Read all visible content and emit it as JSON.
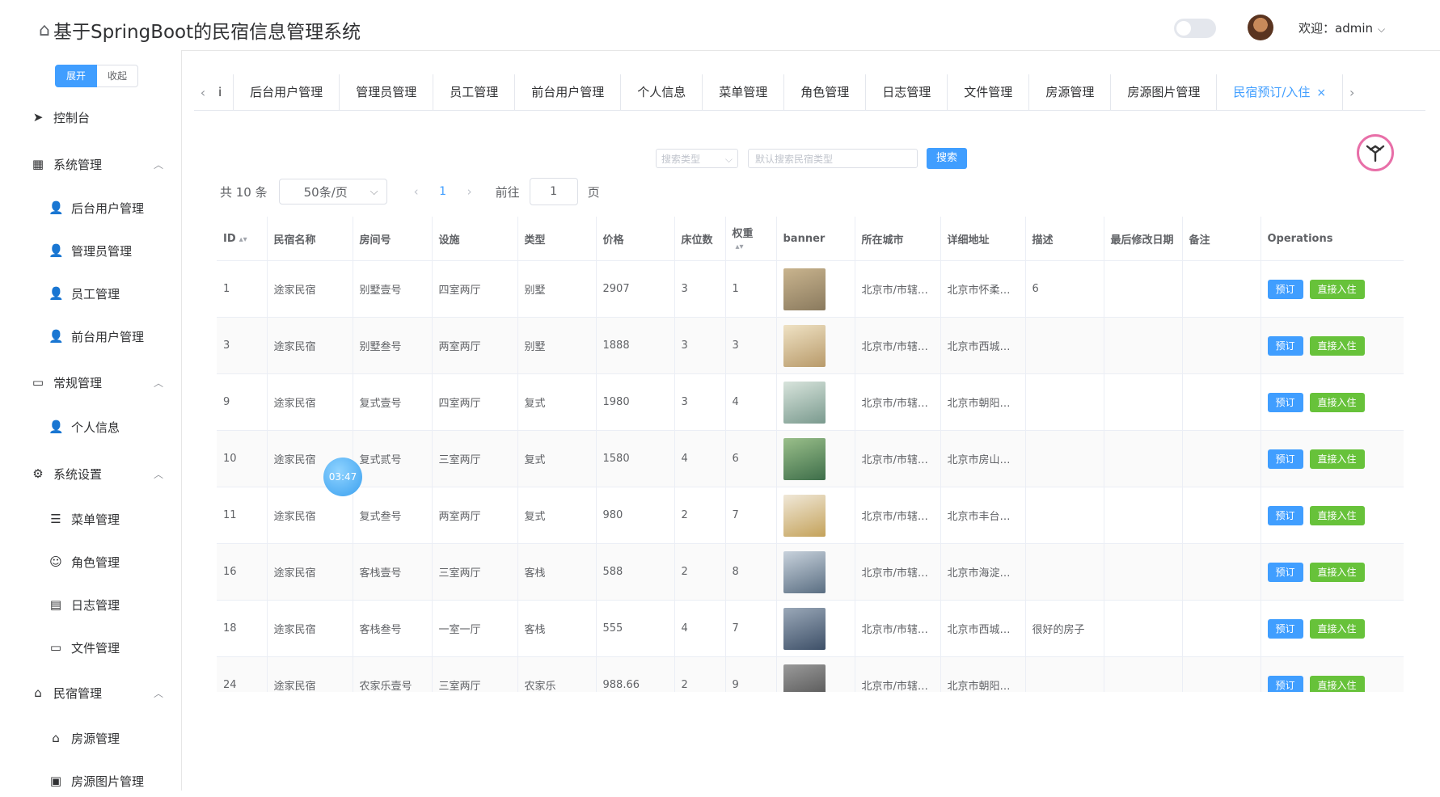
{
  "header": {
    "title": "基于SpringBoot的民宿信息管理系统",
    "welcome": "欢迎：admin"
  },
  "sidebar": {
    "expand_label": "展开",
    "collapse_label": "收起",
    "items": [
      {
        "label": "控制台",
        "icon": "send-icon"
      },
      {
        "label": "系统管理",
        "icon": "grid-icon"
      },
      {
        "label": "后台用户管理",
        "icon": "user-icon"
      },
      {
        "label": "管理员管理",
        "icon": "user-icon"
      },
      {
        "label": "员工管理",
        "icon": "user-icon"
      },
      {
        "label": "前台用户管理",
        "icon": "user-icon"
      },
      {
        "label": "常规管理",
        "icon": "card-icon"
      },
      {
        "label": "个人信息",
        "icon": "user-icon"
      },
      {
        "label": "系统设置",
        "icon": "gear-icon"
      },
      {
        "label": "菜单管理",
        "icon": "sliders-icon"
      },
      {
        "label": "角色管理",
        "icon": "user-outline-icon"
      },
      {
        "label": "日志管理",
        "icon": "calendar-icon"
      },
      {
        "label": "文件管理",
        "icon": "folder-icon"
      },
      {
        "label": "民宿管理",
        "icon": "home-icon"
      },
      {
        "label": "房源管理",
        "icon": "home-icon"
      },
      {
        "label": "房源图片管理",
        "icon": "image-icon"
      }
    ]
  },
  "tabs": [
    {
      "label": "i"
    },
    {
      "label": "后台用户管理"
    },
    {
      "label": "管理员管理"
    },
    {
      "label": "员工管理"
    },
    {
      "label": "前台用户管理"
    },
    {
      "label": "个人信息"
    },
    {
      "label": "菜单管理"
    },
    {
      "label": "角色管理"
    },
    {
      "label": "日志管理"
    },
    {
      "label": "文件管理"
    },
    {
      "label": "房源管理"
    },
    {
      "label": "房源图片管理"
    },
    {
      "label": "民宿预订/入住",
      "active": true
    }
  ],
  "search": {
    "type_placeholder": "搜索类型",
    "input_placeholder": "默认搜索民宿类型",
    "button": "搜索"
  },
  "pagination": {
    "total": "共 10 条",
    "page_size": "50条/页",
    "current_page": "1",
    "goto_label": "前往",
    "goto_value": "1",
    "page_suffix": "页"
  },
  "table": {
    "headers": [
      "ID",
      "民宿名称",
      "房间号",
      "设施",
      "类型",
      "价格",
      "床位数",
      "权重",
      "banner",
      "所在城市",
      "详细地址",
      "描述",
      "最后修改日期",
      "备注",
      "Operations"
    ],
    "book_label": "预订",
    "checkin_label": "直接入住",
    "rows": [
      {
        "id": "1",
        "name": "途家民宿",
        "room": "别墅壹号",
        "facility": "四室两厅",
        "type": "别墅",
        "price": "2907",
        "beds": "3",
        "weight": "1",
        "city": "北京市/市辖…",
        "address": "北京市怀柔…",
        "desc": "6",
        "modified": "",
        "note": ""
      },
      {
        "id": "3",
        "name": "途家民宿",
        "room": "别墅叁号",
        "facility": "两室两厅",
        "type": "别墅",
        "price": "1888",
        "beds": "3",
        "weight": "3",
        "city": "北京市/市辖…",
        "address": "北京市西城…",
        "desc": "",
        "modified": "",
        "note": ""
      },
      {
        "id": "9",
        "name": "途家民宿",
        "room": "复式壹号",
        "facility": "四室两厅",
        "type": "复式",
        "price": "1980",
        "beds": "3",
        "weight": "4",
        "city": "北京市/市辖…",
        "address": "北京市朝阳…",
        "desc": "",
        "modified": "",
        "note": ""
      },
      {
        "id": "10",
        "name": "途家民宿",
        "room": "复式贰号",
        "facility": "三室两厅",
        "type": "复式",
        "price": "1580",
        "beds": "4",
        "weight": "6",
        "city": "北京市/市辖…",
        "address": "北京市房山…",
        "desc": "",
        "modified": "",
        "note": ""
      },
      {
        "id": "11",
        "name": "途家民宿",
        "room": "复式叁号",
        "facility": "两室两厅",
        "type": "复式",
        "price": "980",
        "beds": "2",
        "weight": "7",
        "city": "北京市/市辖…",
        "address": "北京市丰台…",
        "desc": "",
        "modified": "",
        "note": ""
      },
      {
        "id": "16",
        "name": "途家民宿",
        "room": "客栈壹号",
        "facility": "三室两厅",
        "type": "客栈",
        "price": "588",
        "beds": "2",
        "weight": "8",
        "city": "北京市/市辖…",
        "address": "北京市海淀…",
        "desc": "",
        "modified": "",
        "note": ""
      },
      {
        "id": "18",
        "name": "途家民宿",
        "room": "客栈叁号",
        "facility": "一室一厅",
        "type": "客栈",
        "price": "555",
        "beds": "4",
        "weight": "7",
        "city": "北京市/市辖…",
        "address": "北京市西城…",
        "desc": "很好的房子",
        "modified": "",
        "note": ""
      },
      {
        "id": "24",
        "name": "途家民宿",
        "room": "农家乐壹号",
        "facility": "三室两厅",
        "type": "农家乐",
        "price": "988.66",
        "beds": "2",
        "weight": "9",
        "city": "北京市/市辖…",
        "address": "北京市朝阳…",
        "desc": "",
        "modified": "",
        "note": ""
      }
    ]
  },
  "timer": "03:47",
  "colors": {
    "primary": "#409eff",
    "success": "#67c23a"
  }
}
